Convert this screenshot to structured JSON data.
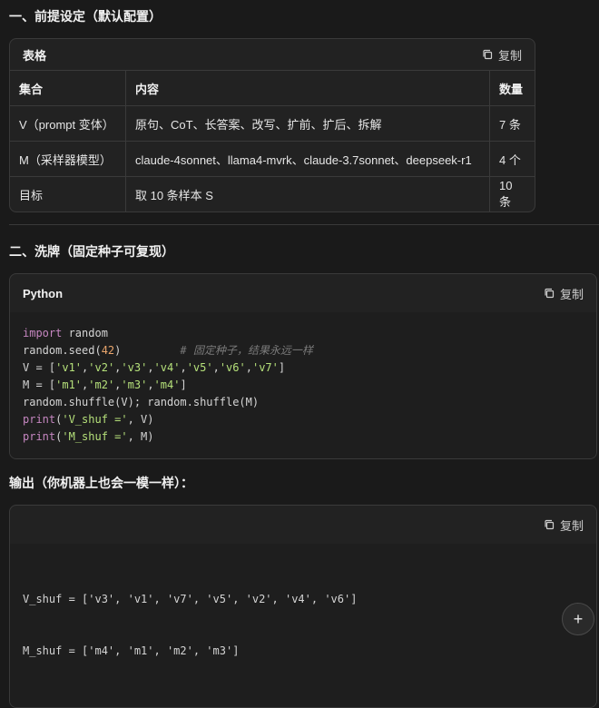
{
  "section1": {
    "title": "一、前提设定（默认配置）"
  },
  "table_card": {
    "title": "表格",
    "copy_label": "复制",
    "headers": [
      "集合",
      "内容",
      "数量"
    ],
    "rows": [
      [
        "V（prompt 变体）",
        "原句、CoT、长答案、改写、扩前、扩后、拆解",
        "7 条"
      ],
      [
        "M（采样器模型）",
        "claude-4sonnet、llama4-mvrk、claude-3.7sonnet、deepseek-r1",
        "4 个"
      ],
      [
        "目标",
        "取 10 条样本 S",
        "10 条"
      ]
    ]
  },
  "section2": {
    "title": "二、洗牌（固定种子可复现）"
  },
  "code_card": {
    "language": "Python",
    "copy_label": "复制",
    "lines": [
      "import random",
      "random.seed(42)         # 固定种子，结果永远一样",
      "V = ['v1','v2','v3','v4','v5','v6','v7']",
      "M = ['m1','m2','m3','m4']",
      "random.shuffle(V); random.shuffle(M)",
      "print('V_shuf =', V)",
      "print('M_shuf =', M)"
    ]
  },
  "output_heading": {
    "title": "输出（你机器上也会一模一样）："
  },
  "output_card": {
    "copy_label": "复制",
    "lines": [
      "V_shuf = ['v3', 'v1', 'v7', 'v5', 'v2', 'v4', 'v6']",
      "M_shuf = ['m4', 'm1', 'm2', 'm3']"
    ]
  },
  "fab": {
    "symbol": "+"
  },
  "colors": {
    "background": "#1a1a1a",
    "card": "#222222",
    "border": "#3a3a3a",
    "keyword": "#c586c0",
    "string": "#b5e07a",
    "number": "#e9a56c",
    "comment": "#7a7a7a"
  },
  "icons": {
    "copy": "copy-icon",
    "fab": "plus-icon"
  }
}
